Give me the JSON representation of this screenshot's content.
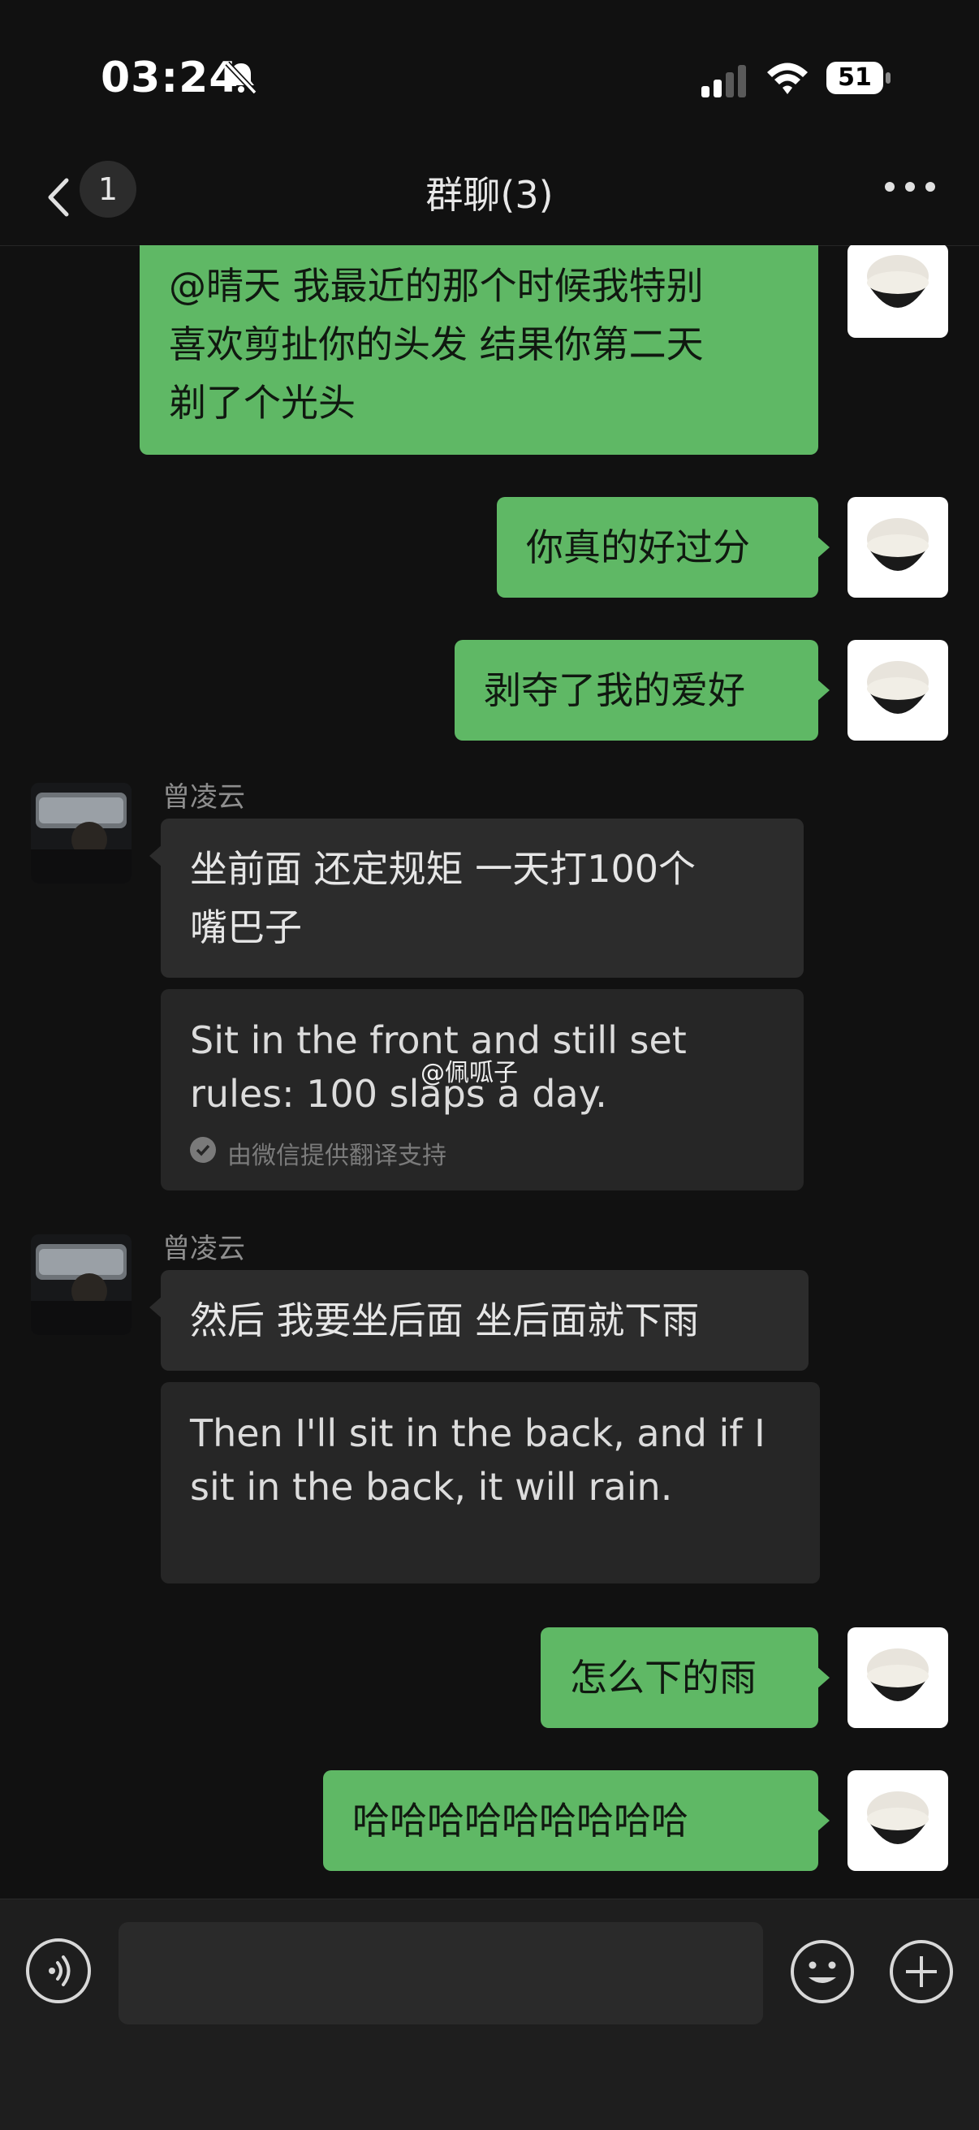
{
  "status": {
    "time": "03:24",
    "battery": "51"
  },
  "nav": {
    "unread_badge": "1",
    "title": "群聊(3)"
  },
  "messages": [
    {
      "type": "outgoing",
      "lines": [
        "@晴天 我最近的那个时候我特别",
        "喜欢剪扯你的头发 结果你第二天",
        "剃了个光头"
      ]
    },
    {
      "type": "outgoing",
      "text": "你真的好过分"
    },
    {
      "type": "outgoing",
      "text": "剥夺了我的爱好"
    },
    {
      "type": "incoming",
      "sender": "曾凌云",
      "lines": [
        "坐前面 还定规矩 一天打100个",
        "嘴巴子"
      ],
      "translation": [
        "Sit in the front and still set",
        "rules: 100 slaps a day."
      ],
      "translation_note": "由微信提供翻译支持"
    },
    {
      "type": "incoming",
      "sender": "曾凌云",
      "text": "然后 我要坐后面 坐后面就下雨",
      "translation": [
        "Then I'll sit in the back, and if I",
        "sit in the back, it will rain."
      ]
    },
    {
      "type": "outgoing",
      "text": "怎么下的雨"
    },
    {
      "type": "outgoing",
      "text": "哈哈哈哈哈哈哈哈哈"
    }
  ],
  "watermark": "@佩呱子",
  "input": {
    "placeholder": ""
  }
}
